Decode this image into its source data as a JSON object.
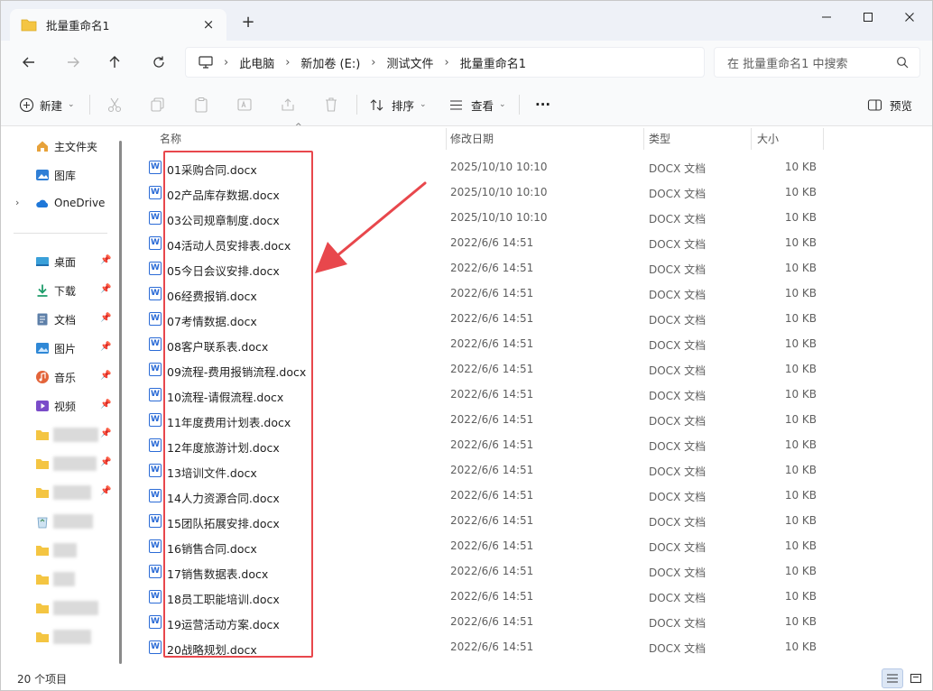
{
  "window": {
    "tab_title": "批量重命名1",
    "new_tab": "+",
    "close_tab": "×"
  },
  "nav": {
    "breadcrumb": [
      "此电脑",
      "新加卷 (E:)",
      "测试文件",
      "批量重命名1"
    ],
    "separator": "›",
    "search_placeholder": "在 批量重命名1 中搜索"
  },
  "toolbar": {
    "new_label": "新建",
    "sort_label": "排序",
    "view_label": "查看",
    "more_label": "···",
    "preview_label": "预览"
  },
  "sidebar": {
    "items": [
      {
        "label": "主文件夹",
        "icon": "home-icon"
      },
      {
        "label": "图库",
        "icon": "gallery-icon"
      },
      {
        "label": "OneDrive",
        "icon": "onedrive-icon"
      },
      {
        "label": "桌面",
        "icon": "desktop-icon"
      },
      {
        "label": "下载",
        "icon": "download-icon"
      },
      {
        "label": "文档",
        "icon": "document-icon"
      },
      {
        "label": "图片",
        "icon": "picture-icon"
      },
      {
        "label": "音乐",
        "icon": "music-icon"
      },
      {
        "label": "视频",
        "icon": "video-icon"
      }
    ]
  },
  "columns": {
    "name": "名称",
    "date": "修改日期",
    "type": "类型",
    "size": "大小"
  },
  "files": [
    {
      "name": "01采购合同.docx",
      "date": "2025/10/10 10:10",
      "type": "DOCX 文档",
      "size": "10 KB"
    },
    {
      "name": "02产品库存数据.docx",
      "date": "2025/10/10 10:10",
      "type": "DOCX 文档",
      "size": "10 KB"
    },
    {
      "name": "03公司规章制度.docx",
      "date": "2025/10/10 10:10",
      "type": "DOCX 文档",
      "size": "10 KB"
    },
    {
      "name": "04活动人员安排表.docx",
      "date": "2022/6/6 14:51",
      "type": "DOCX 文档",
      "size": "10 KB"
    },
    {
      "name": "05今日会议安排.docx",
      "date": "2022/6/6 14:51",
      "type": "DOCX 文档",
      "size": "10 KB"
    },
    {
      "name": "06经费报销.docx",
      "date": "2022/6/6 14:51",
      "type": "DOCX 文档",
      "size": "10 KB"
    },
    {
      "name": "07考情数据.docx",
      "date": "2022/6/6 14:51",
      "type": "DOCX 文档",
      "size": "10 KB"
    },
    {
      "name": "08客户联系表.docx",
      "date": "2022/6/6 14:51",
      "type": "DOCX 文档",
      "size": "10 KB"
    },
    {
      "name": "09流程-费用报销流程.docx",
      "date": "2022/6/6 14:51",
      "type": "DOCX 文档",
      "size": "10 KB"
    },
    {
      "name": "10流程-请假流程.docx",
      "date": "2022/6/6 14:51",
      "type": "DOCX 文档",
      "size": "10 KB"
    },
    {
      "name": "11年度费用计划表.docx",
      "date": "2022/6/6 14:51",
      "type": "DOCX 文档",
      "size": "10 KB"
    },
    {
      "name": "12年度旅游计划.docx",
      "date": "2022/6/6 14:51",
      "type": "DOCX 文档",
      "size": "10 KB"
    },
    {
      "name": "13培训文件.docx",
      "date": "2022/6/6 14:51",
      "type": "DOCX 文档",
      "size": "10 KB"
    },
    {
      "name": "14人力资源合同.docx",
      "date": "2022/6/6 14:51",
      "type": "DOCX 文档",
      "size": "10 KB"
    },
    {
      "name": "15团队拓展安排.docx",
      "date": "2022/6/6 14:51",
      "type": "DOCX 文档",
      "size": "10 KB"
    },
    {
      "name": "16销售合同.docx",
      "date": "2022/6/6 14:51",
      "type": "DOCX 文档",
      "size": "10 KB"
    },
    {
      "name": "17销售数据表.docx",
      "date": "2022/6/6 14:51",
      "type": "DOCX 文档",
      "size": "10 KB"
    },
    {
      "name": "18员工职能培训.docx",
      "date": "2022/6/6 14:51",
      "type": "DOCX 文档",
      "size": "10 KB"
    },
    {
      "name": "19运营活动方案.docx",
      "date": "2022/6/6 14:51",
      "type": "DOCX 文档",
      "size": "10 KB"
    },
    {
      "name": "20战略规划.docx",
      "date": "2022/6/6 14:51",
      "type": "DOCX 文档",
      "size": "10 KB"
    }
  ],
  "status": {
    "item_count": "20 个项目"
  },
  "colors": {
    "highlight": "#e8474c",
    "word_blue": "#2b6bd6",
    "folder_yellow": "#f4c542"
  }
}
